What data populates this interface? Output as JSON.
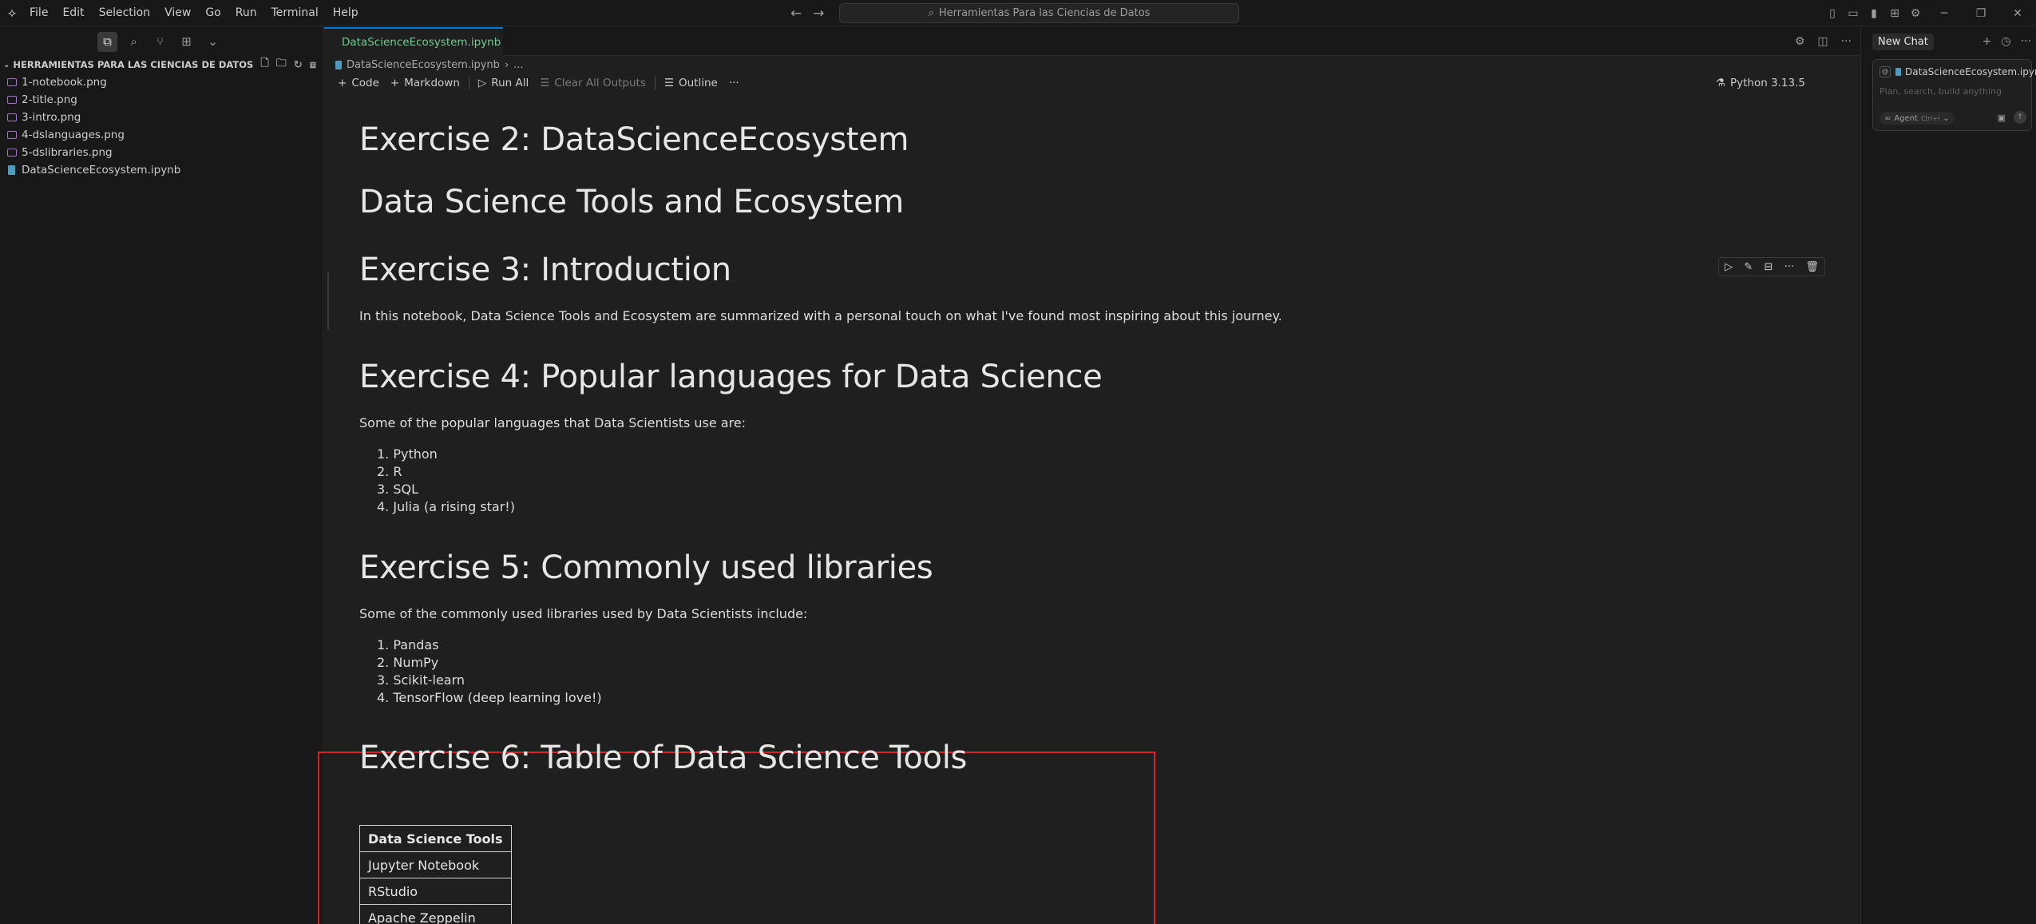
{
  "menubar": {
    "items": [
      "File",
      "Edit",
      "Selection",
      "View",
      "Go",
      "Run",
      "Terminal",
      "Help"
    ]
  },
  "titlebar": {
    "search_text": "Herramientas Para las Ciencias de Datos"
  },
  "sidebar": {
    "section_title": "HERRAMIENTAS PARA LAS CIENCIAS DE DATOS",
    "files": [
      {
        "name": "1-notebook.png",
        "type": "image"
      },
      {
        "name": "2-title.png",
        "type": "image"
      },
      {
        "name": "3-intro.png",
        "type": "image"
      },
      {
        "name": "4-dslanguages.png",
        "type": "image"
      },
      {
        "name": "5-dslibraries.png",
        "type": "image"
      },
      {
        "name": "DataScienceEcosystem.ipynb",
        "type": "notebook"
      }
    ]
  },
  "editor": {
    "tab_label": "DataScienceEcosystem.ipynb",
    "breadcrumb": {
      "file": "DataScienceEcosystem.ipynb",
      "more": "..."
    },
    "toolbar": {
      "code": "Code",
      "markdown": "Markdown",
      "run_all": "Run All",
      "clear_outputs": "Clear All Outputs",
      "outline": "Outline",
      "more": "···"
    },
    "kernel": "Python 3.13.5"
  },
  "notebook": {
    "ex2_title": "Exercise 2: DataScienceEcosystem",
    "main_title": "Data Science Tools and Ecosystem",
    "ex3_title": "Exercise 3: Introduction",
    "ex3_text": "In this notebook, Data Science Tools and Ecosystem are summarized with a personal touch on what I've found most inspiring about this journey.",
    "ex4_title": "Exercise 4: Popular languages for Data Science",
    "ex4_text": "Some of the popular languages that Data Scientists use are:",
    "languages": [
      "1. Python",
      "2. R",
      "3. SQL",
      "4. Julia (a rising star!)"
    ],
    "ex5_title": "Exercise 5: Commonly used libraries",
    "ex5_text": "Some of the commonly used libraries used by Data Scientists include:",
    "libraries": [
      "1. Pandas",
      "2. NumPy",
      "3. Scikit-learn",
      "4. TensorFlow (deep learning love!)"
    ],
    "ex6_title": "Exercise 6: Table of Data Science Tools",
    "table": {
      "header": "Data Science Tools",
      "rows": [
        "Jupyter Notebook",
        "RStudio",
        "Apache Zeppelin"
      ]
    }
  },
  "chat": {
    "tab_label": "New Chat",
    "context_file": "DataScienceEcosystem.ipynb",
    "placeholder": "Plan, search, build anything",
    "agent_label": "Agent",
    "agent_shortcut": "Ctrl+I"
  }
}
